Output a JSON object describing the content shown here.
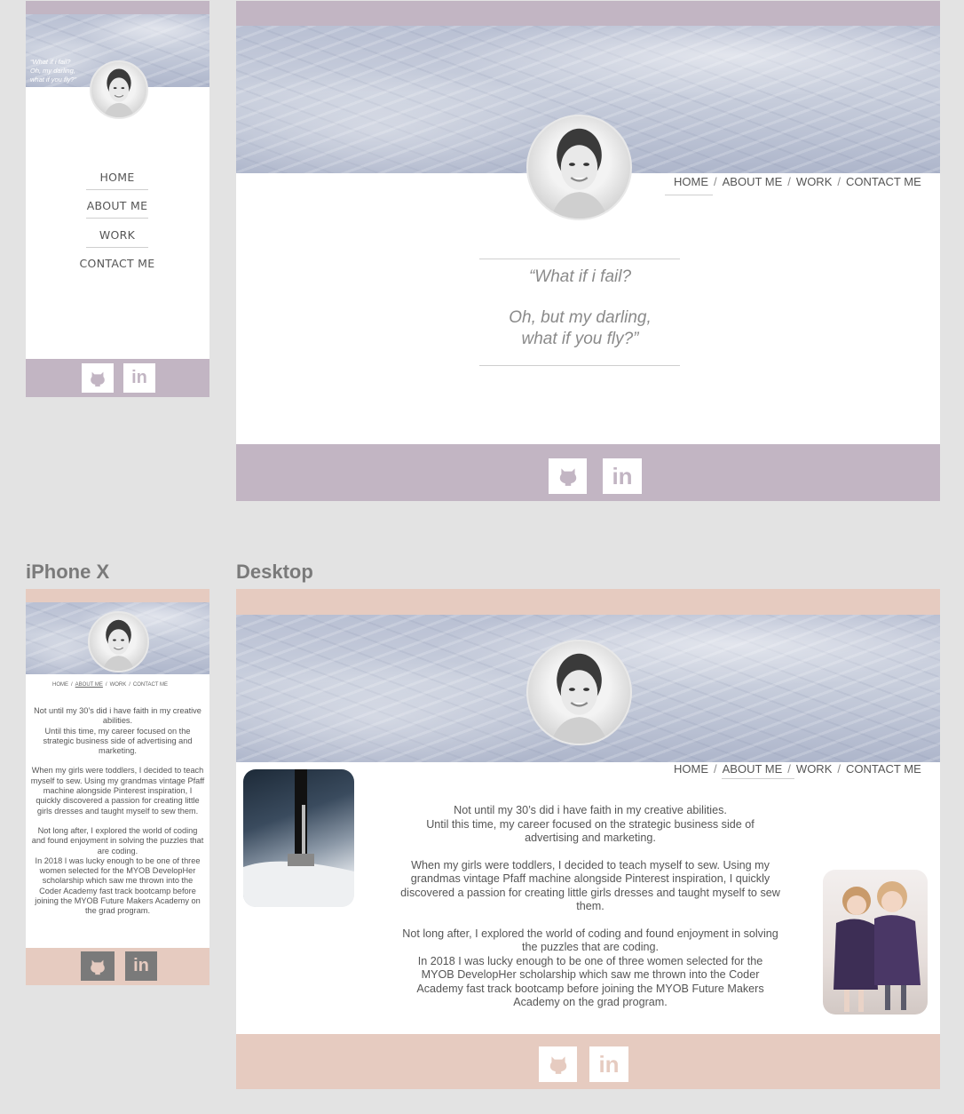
{
  "labels": {
    "iphone": "iPhone X",
    "desktop": "Desktop"
  },
  "quote": {
    "line1": "“What if i fail?",
    "line2": "Oh, but my darling,",
    "line3": "what if you fly?”"
  },
  "mobile_quote": {
    "line1": "“What if i fail?",
    "line2": "Oh, my darling,",
    "line3": "what if you fly?”"
  },
  "nav": {
    "home": "HOME",
    "about": "ABOUT ME",
    "work": "WORK",
    "contact": "CONTACT ME",
    "separator": "/"
  },
  "about": {
    "p1a": "Not until my 30’s did i have faith in my creative abilities.",
    "p1b": "Until this time, my career focused on the strategic business side of advertising and marketing.",
    "p2": "When my girls were toddlers, I decided to teach myself to sew.  Using my grandmas vintage Pfaff machine alongside Pinterest inspiration, I quickly discovered a passion for creating little girls dresses and taught myself to sew them.",
    "p3a": "Not long after, I explored the world of coding and found enjoyment in solving the puzzles that are coding.",
    "p3b": "In 2018 I was lucky enough to be one of three women selected for the MYOB DevelopHer scholarship which saw me thrown into the Coder Academy fast track bootcamp before joining the MYOB Future Makers Academy on the grad program."
  },
  "social": {
    "github": "github-icon",
    "linkedin": "linkedin-icon",
    "linkedin_text": "in"
  },
  "colors": {
    "lilac": "#c2b5c3",
    "peach": "#e6cbc0",
    "background": "#e3e3e3"
  }
}
